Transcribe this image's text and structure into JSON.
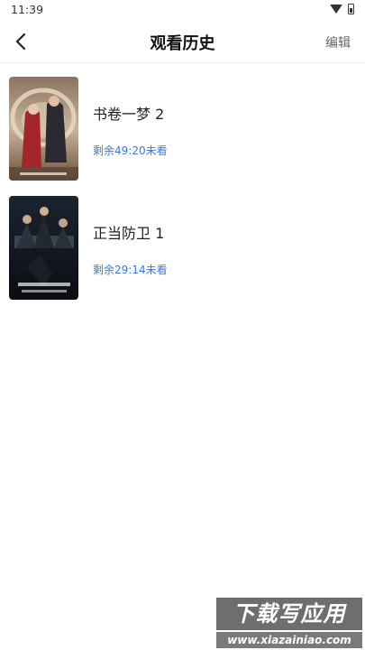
{
  "status_bar": {
    "time": "11:39",
    "icons": [
      "wifi-icon",
      "battery-icon"
    ]
  },
  "header": {
    "back_icon": "chevron-left-icon",
    "title": "观看历史",
    "edit_label": "编辑"
  },
  "history": [
    {
      "title": "书卷一梦 2",
      "progress_text": "剩余49:20未看"
    },
    {
      "title": "正当防卫 1",
      "progress_text": "剩余29:14未看"
    }
  ],
  "watermark": {
    "main": "下载写应用",
    "url": "www.xiazainiao.com"
  },
  "colors": {
    "accent": "#3a78e0",
    "title_text": "#111111",
    "secondary_text": "#666666"
  }
}
